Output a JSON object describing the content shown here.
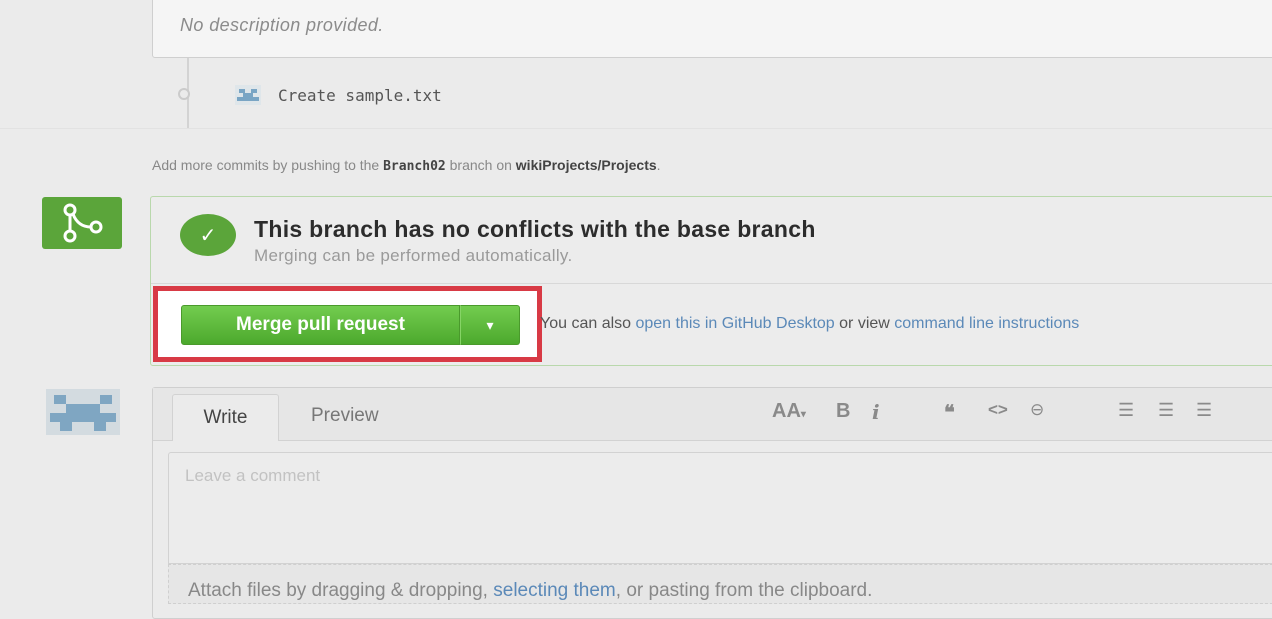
{
  "description": {
    "text": "No description provided."
  },
  "commit": {
    "message": "Create sample.txt"
  },
  "hint": {
    "prefix": "Add more commits by pushing to the ",
    "branch": "Branch02",
    "middle": " branch on ",
    "repo": "wikiProjects/Projects",
    "suffix": "."
  },
  "merge": {
    "title": "This branch has no conflicts with the base branch",
    "subtitle": "Merging can be performed automatically.",
    "button_label": "Merge pull request",
    "dropdown_glyph": "▾",
    "check_glyph": "✓",
    "also_prefix": "You can also ",
    "desktop_link": "open this in GitHub Desktop",
    "also_middle": " or view ",
    "cli_link": "command line instructions"
  },
  "comment": {
    "tab_write": "Write",
    "tab_preview": "Preview",
    "toolbar": {
      "heading": "AA",
      "bold": "B",
      "italic": "i",
      "quote": "❝",
      "code": "<>",
      "link": "⊖",
      "ul": "☰",
      "ol": "☰",
      "task": "☰"
    },
    "placeholder": "Leave a comment",
    "attach_prefix": "Attach files by dragging & dropping, ",
    "attach_link": "selecting them",
    "attach_suffix": ", or pasting from the clipboard."
  },
  "colors": {
    "accent_green": "#5ba53a",
    "highlight_red": "#d83a45",
    "link_blue": "#5b89b8"
  }
}
